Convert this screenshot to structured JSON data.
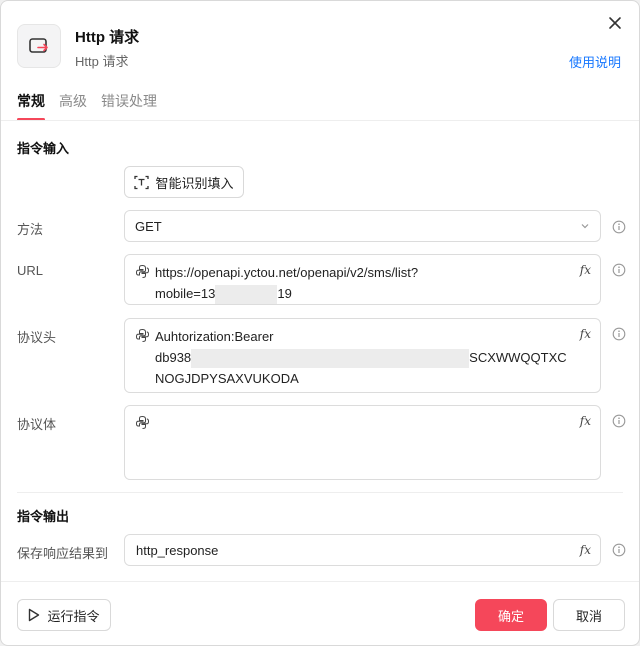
{
  "header": {
    "title": "Http 请求",
    "subtitle": "Http 请求",
    "help_link": "使用说明"
  },
  "tabs": [
    {
      "label": "常规",
      "active": true
    },
    {
      "label": "高级",
      "active": false
    },
    {
      "label": "错误处理",
      "active": false
    }
  ],
  "input_section": {
    "title": "指令输入",
    "smart_fill_label": "智能识别填入",
    "method": {
      "label": "方法",
      "value": "GET"
    },
    "url": {
      "label": "URL",
      "line1": "https://openapi.yctou.net/openapi/v2/sms/list?",
      "line2_prefix": "mobile=13",
      "line2_suffix": "19"
    },
    "headers": {
      "label": "协议头",
      "line1": "Auhtorization:Bearer",
      "line2_prefix": "db938",
      "line2_suffix": "SCXWWQQTXC",
      "line3": "NOGJDPYSAXVUKODA"
    },
    "body": {
      "label": "协议体",
      "value": ""
    }
  },
  "output_section": {
    "title": "指令输出",
    "save_label": "保存响应结果到",
    "save_value": "http_response"
  },
  "footer": {
    "run_label": "运行指令",
    "ok_label": "确定",
    "cancel_label": "取消"
  },
  "colors": {
    "accent": "#f5475a",
    "link": "#1677ff"
  },
  "icons": {
    "header": "http-request-icon",
    "close": "close-icon",
    "smart_fill": "text-scan-icon",
    "variable": "python-icon",
    "expression": "fx-icon",
    "info": "info-icon",
    "run": "play-icon",
    "dropdown": "chevron-down-icon"
  }
}
